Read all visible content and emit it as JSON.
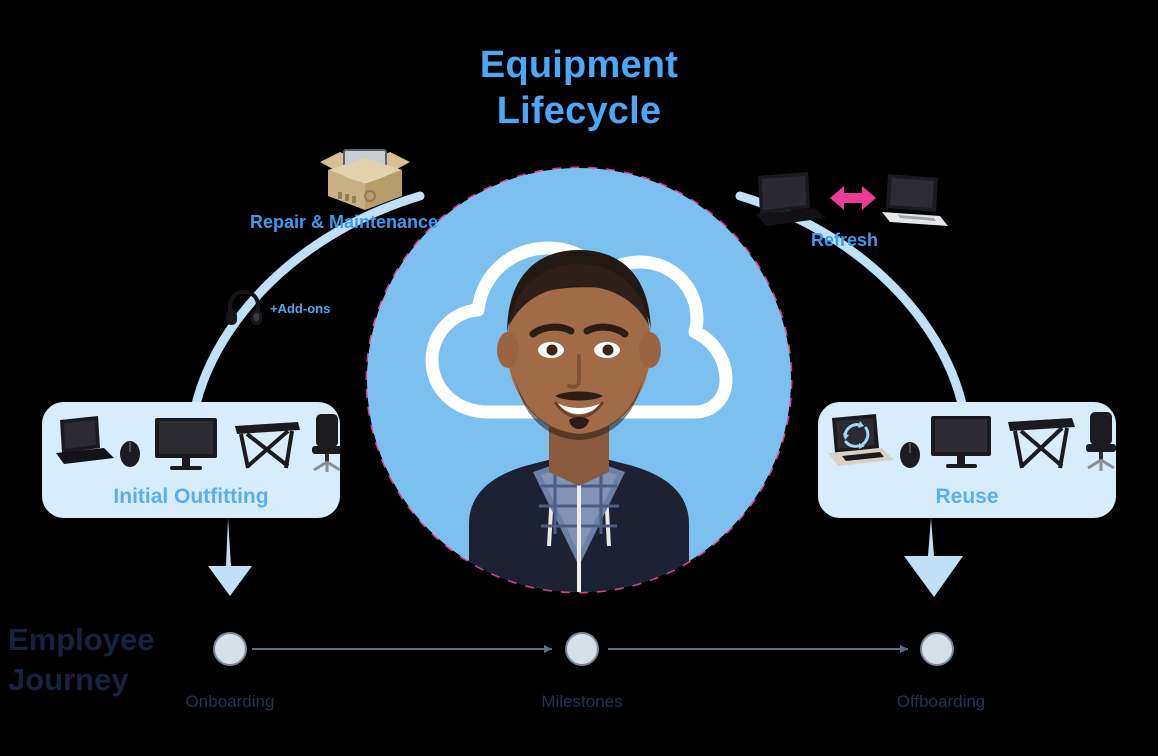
{
  "title": {
    "line1": "Equipment",
    "line2": "Lifecycle",
    "color": "#4BA7F7"
  },
  "center": {
    "circle_color": "#7CC0F0",
    "ring_color": "#EC3C96",
    "cloud_icon": "cloud-icon",
    "portrait_alt": "smiling-employee-portrait"
  },
  "stages": {
    "repair": {
      "label": "Repair & Maintenance",
      "icon": "box-with-laptop-icon"
    },
    "refresh": {
      "label": "Refresh",
      "icon": "two-laptops-swap-icon",
      "arrow_color": "#EC3C96"
    },
    "addons": {
      "label": "+Add-ons",
      "icon": "headphones-icon"
    }
  },
  "cards": [
    {
      "id": "initial-outfitting",
      "label": "Initial Outfitting",
      "bg": "#D8EDFB",
      "items": [
        "laptop-icon",
        "mouse-icon",
        "monitor-icon",
        "desk-icon",
        "office-chair-icon"
      ]
    },
    {
      "id": "reuse",
      "label": "Reuse",
      "bg": "#D8EDFB",
      "items": [
        "laptop-recycle-icon",
        "mouse-icon",
        "monitor-icon",
        "desk-icon",
        "office-chair-icon"
      ]
    }
  ],
  "journey": {
    "title_line1": "Employee",
    "title_line2": "Journey",
    "title_color": "#16233F",
    "nodes": [
      {
        "label": "Onboarding"
      },
      {
        "label": "Milestones"
      },
      {
        "label": "Offboarding"
      }
    ]
  },
  "arrows": {
    "down_left": "down-arrow-onboarding",
    "down_right": "down-arrow-offboarding",
    "arc_left": "lifecycle-arc-left",
    "arc_right": "lifecycle-arc-right",
    "color": "#BFE0F7"
  }
}
